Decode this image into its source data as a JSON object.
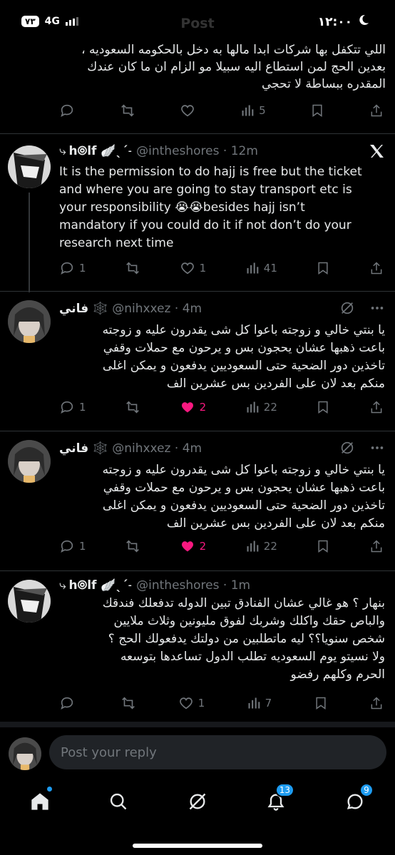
{
  "status_bar": {
    "battery": "٧٣",
    "network": "4G",
    "time": "١٢:٠٠",
    "screen_title": "Post"
  },
  "partial_post": {
    "text_lines": [
      "اللي تتكفل بها شركات ابدا مالها به دخل بالحكومه السعوديه ،",
      "بعدين الحج لمن استطاع اليه سبيلا مو الزام ان ما كان عندك",
      "المقدره ببساطة لا تحجي"
    ],
    "views": "5"
  },
  "tweets": [
    {
      "name": "h⦾lf 🪽ˎˊ˗",
      "handle": "@intheshores",
      "time": "12m",
      "text_lines": [
        "It is the permission to do hajj is free but the ticket",
        "and where you are going to stay transport etc is",
        "your responsibility 😭😭besides hajj isn’t",
        "mandatory if you could do it if not don’t do your",
        "research next time"
      ],
      "replies": "1",
      "likes": "1",
      "views": "41"
    },
    {
      "name": "فاني 🕸️",
      "handle": "@nihxxez",
      "time": "4m",
      "text_lines": [
        "يا بنتي خالي و زوجته باعوا كل شى يقدرون عليه و زوجته",
        "باعت ذهبها عشان يحجون بس و يرحون مع حملات وقفي",
        "تاخذين دور الضحية حتى السعوديين يدفعون و يمكن اغلى",
        "منكم بعد لان على الفردين بس عشرين الف"
      ],
      "replies": "1",
      "likes": "2",
      "views": "22"
    },
    {
      "name": "فاني 🕸️",
      "handle": "@nihxxez",
      "time": "4m",
      "text_lines": [
        "يا بنتي خالي و زوجته باعوا كل شى يقدرون عليه و زوجته",
        "باعت ذهبها عشان يحجون بس و يرحون مع حملات وقفي",
        "تاخذين دور الضحية حتى السعوديين يدفعون و يمكن اغلى",
        "منكم بعد لان على الفردين بس عشرين الف"
      ],
      "replies": "1",
      "likes": "2",
      "views": "22"
    },
    {
      "name": "h⦾lf 🪽ˎˊ˗",
      "handle": "@intheshores",
      "time": "1m",
      "text_lines": [
        "بنهار ؟ هو غالي عشان الفنادق تبين الدوله تدفعلك فندقك",
        "والباص حقك واكلك وشربك لفوق مليونين وثلاث ملايين",
        "شخص سنويا؟؟ ليه ماتطلبين من دولتك يدفعولك الحج ؟",
        "ولا نسيتو يوم السعوديه تطلب الدول تساعدها بتوسعه",
        "الحرم وكلهم رفضو"
      ],
      "replies": "",
      "likes": "1",
      "views": "7"
    }
  ],
  "reply_bar": {
    "placeholder": "Post your reply"
  },
  "bottom_nav": {
    "notifications_badge": "13",
    "messages_badge": "9"
  },
  "colors": {
    "background": "#000000",
    "text": "#e7e9ea",
    "muted": "#71767b",
    "like": "#f91880",
    "accent": "#1d9bf0",
    "divider": "#2f3336"
  }
}
